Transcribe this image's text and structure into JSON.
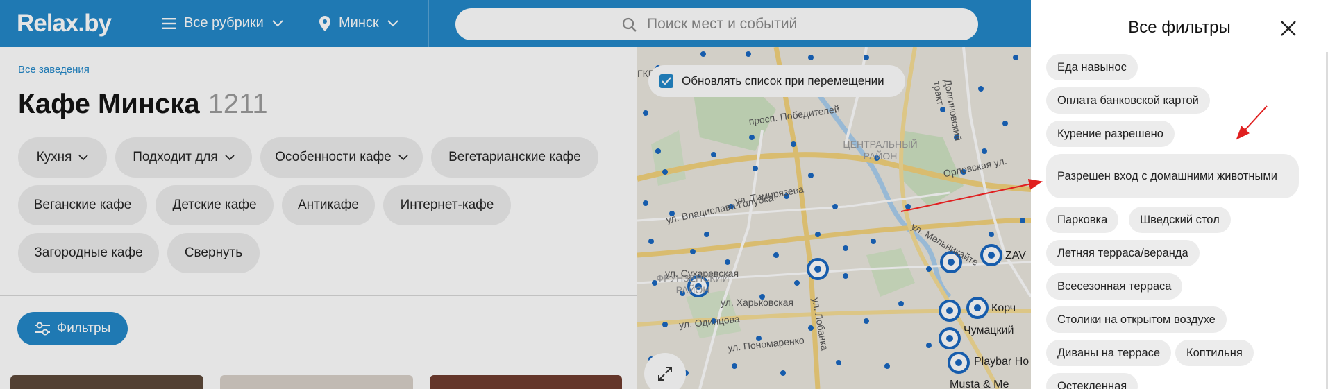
{
  "header": {
    "logo": "Relax.by",
    "rubrics_label": "Все рубрики",
    "city_label": "Минск",
    "search_placeholder": "Поиск мест и событий",
    "brand_color": "#1f86c8"
  },
  "breadcrumb": "Все заведения",
  "page_title": "Кафе Минска",
  "page_count": "1211",
  "chips": [
    {
      "label": "Кухня",
      "dropdown": true
    },
    {
      "label": "Подходит для",
      "dropdown": true
    },
    {
      "label": "Особенности кафе",
      "dropdown": true
    },
    {
      "label": "Вегетарианские кафе",
      "dropdown": false
    },
    {
      "label": "Веганские кафе",
      "dropdown": false
    },
    {
      "label": "Детские кафе",
      "dropdown": false
    },
    {
      "label": "Антикафе",
      "dropdown": false
    },
    {
      "label": "Интернет-кафе",
      "dropdown": false
    },
    {
      "label": "Загородные кафе",
      "dropdown": false
    },
    {
      "label": "Свернуть",
      "dropdown": false
    }
  ],
  "filters_button": "Фильтры",
  "map": {
    "update_checkbox_label": "Обновлять список при перемещении",
    "update_checked": true,
    "labels": [
      "ГКП",
      "просп. Победителей",
      "ул. Тимирязева",
      "ул. Владислава Голубка",
      "Орловская ул.",
      "Долгиновский тракт",
      "ул. Сухаревская",
      "ФРУНЗЕНСКИЙ РАЙОН",
      "ул. Одинцова",
      "ул. Пономаренко",
      "ул. Харьковская",
      "ЦЕНТРАЛЬНЫЙ РАЙОН",
      "ZAV",
      "Корч",
      "Чумацкий",
      "Playbar Ho",
      "Musta & Me",
      "ул. Лобанка",
      "ул. Мельникайте"
    ]
  },
  "filter_panel": {
    "title": "Все фильтры",
    "options": [
      "Еда навынос",
      "Оплата банковской картой",
      "Курение разрешено",
      "Разрешен вход с домашними животными",
      "Парковка",
      "Шведский стол",
      "Летняя терраса/веранда",
      "Всесезонная терраса",
      "Столики на открытом воздухе",
      "Диваны на террасе",
      "Коптильня",
      "Остекленная"
    ]
  },
  "colors": {
    "accent": "#1f86c8",
    "chip_bg": "#ececec",
    "annotation_arrow": "#e02020"
  }
}
